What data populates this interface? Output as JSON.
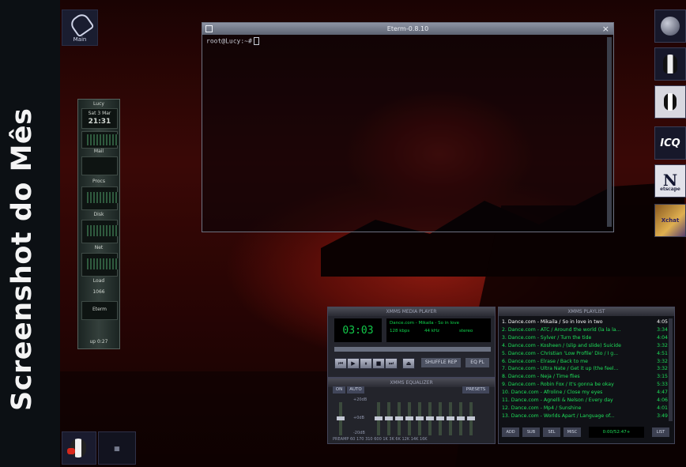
{
  "banner": {
    "title": "Screenshot do Mês"
  },
  "desktop": {
    "main_icon_label": "Main",
    "dock": {
      "host": "Lucy",
      "date": "Sat 3 Mar",
      "time": "21:31",
      "label_mail": "Mail",
      "label_procs": "Procs",
      "label_disk": "Disk",
      "label_net": "Net",
      "label_load": "Load",
      "mem": "1066",
      "eterm_label": "Eterm",
      "uptime": "up 0:27"
    }
  },
  "terminal": {
    "title": "Eterm-0.8.10",
    "prompt": "root@Lucy:~#"
  },
  "player": {
    "title": "XMMS MEDIA PLAYER",
    "time": "03:03",
    "track": "Dance.com - Mikaila - So in love",
    "bitrate": "128 kbps",
    "samplerate": "44 kHz",
    "stereo": "stereo",
    "shuffle_label": "SHUFFLE",
    "rep_label": "REP",
    "eq_label": "EQ",
    "pl_label": "PL"
  },
  "equalizer": {
    "title": "XMMS EQUALIZER",
    "on_label": "ON",
    "auto_label": "AUTO",
    "presets_label": "PRESETS",
    "scale_top": "+20dB",
    "scale_mid": "+0dB",
    "scale_bottom": "-20dB",
    "band_labels": "PREAMP   60 170 310 600 1K 3K 6K 12K 14K 16K"
  },
  "playlist": {
    "title": "XMMS PLAYLIST",
    "items": [
      {
        "title": "1. Dance.com - Mikaila / So in love in two",
        "duration": "4:05",
        "selected": true
      },
      {
        "title": "2. Dance.com - ATC / Around the world (la la la...",
        "duration": "3:34",
        "selected": false
      },
      {
        "title": "3. Dance.com - Sylver / Turn the tide",
        "duration": "4:04",
        "selected": false
      },
      {
        "title": "4. Dance.com - Kosheen / (slip and slide) Suicide",
        "duration": "3:32",
        "selected": false
      },
      {
        "title": "5. Dance.com - Christian 'Low Profile' Dio / I g...",
        "duration": "4:51",
        "selected": false
      },
      {
        "title": "6. Dance.com - Elrase / Back to me",
        "duration": "3:32",
        "selected": false
      },
      {
        "title": "7. Dance.com - Ultra Nate / Get it up (the feel...",
        "duration": "3:32",
        "selected": false
      },
      {
        "title": "8. Dance.com - Neja / Time flies",
        "duration": "3:15",
        "selected": false
      },
      {
        "title": "9. Dance.com - Robin Fox / It's gonna be okay",
        "duration": "5:33",
        "selected": false
      },
      {
        "title": "10. Dance.com - Afroline / Close my eyes",
        "duration": "4:47",
        "selected": false
      },
      {
        "title": "11. Dance.com - Agnelli & Nelson / Every day",
        "duration": "4:06",
        "selected": false
      },
      {
        "title": "12. Dance.com - Mp4 / Sunshine",
        "duration": "4:01",
        "selected": false
      },
      {
        "title": "13. Dance.com - Worlds Apart / Language of...",
        "duration": "3:49",
        "selected": false
      }
    ],
    "btn_add": "ADD",
    "btn_sub": "SUB",
    "btn_sel": "SEL",
    "btn_misc": "MISC",
    "total_time": "0:00/52:47+",
    "btn_list": "LIST"
  },
  "right_dock": {
    "icq_label": "ICQ",
    "netscape_label": "N",
    "netscape_sub": "etscape",
    "xchat_label": "Xchat"
  },
  "colors": {
    "accent_green": "#1ee05a",
    "banner_bg": "#0c1014",
    "desktop_red": "#5a0b08"
  }
}
